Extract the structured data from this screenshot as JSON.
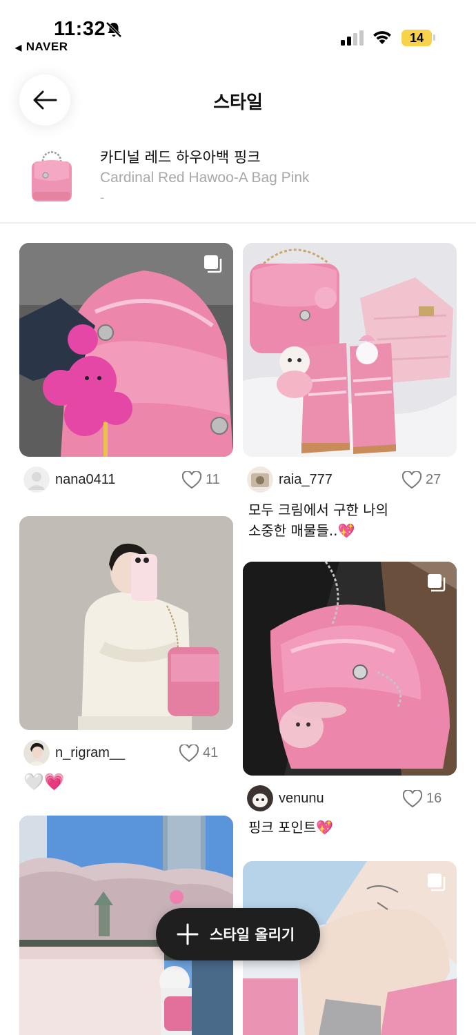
{
  "status_bar": {
    "time": "11:32",
    "back_app": "NAVER",
    "battery": "14"
  },
  "header": {
    "title": "스타일"
  },
  "product": {
    "name_ko": "카디널 레드 하우아백 핑크",
    "name_en": "Cardinal Red Hawoo-A Bag Pink",
    "sub": "-"
  },
  "posts": [
    {
      "username": "nana0411",
      "likes": "11",
      "caption": ""
    },
    {
      "username": "raia_777",
      "likes": "27",
      "caption_line1": "모두 크림에서 구한 나의",
      "caption_line2": "소중한 매물들..💖"
    },
    {
      "username": "n_rigram__",
      "likes": "41",
      "caption": "🤍💗"
    },
    {
      "username": "venunu",
      "likes": "16",
      "caption": "핑크 포인트💖"
    }
  ],
  "fab": {
    "label": "스타일 올리기"
  },
  "colors": {
    "accent_dark": "#1f1f1f",
    "pink": "#ec8fb1",
    "muted": "#a8a8a8",
    "battery": "#f7d24a"
  },
  "icons": [
    "bell-slash-icon",
    "signal-icon",
    "wifi-icon",
    "back-arrow-icon",
    "multi-image-icon",
    "heart-icon",
    "plus-icon"
  ]
}
